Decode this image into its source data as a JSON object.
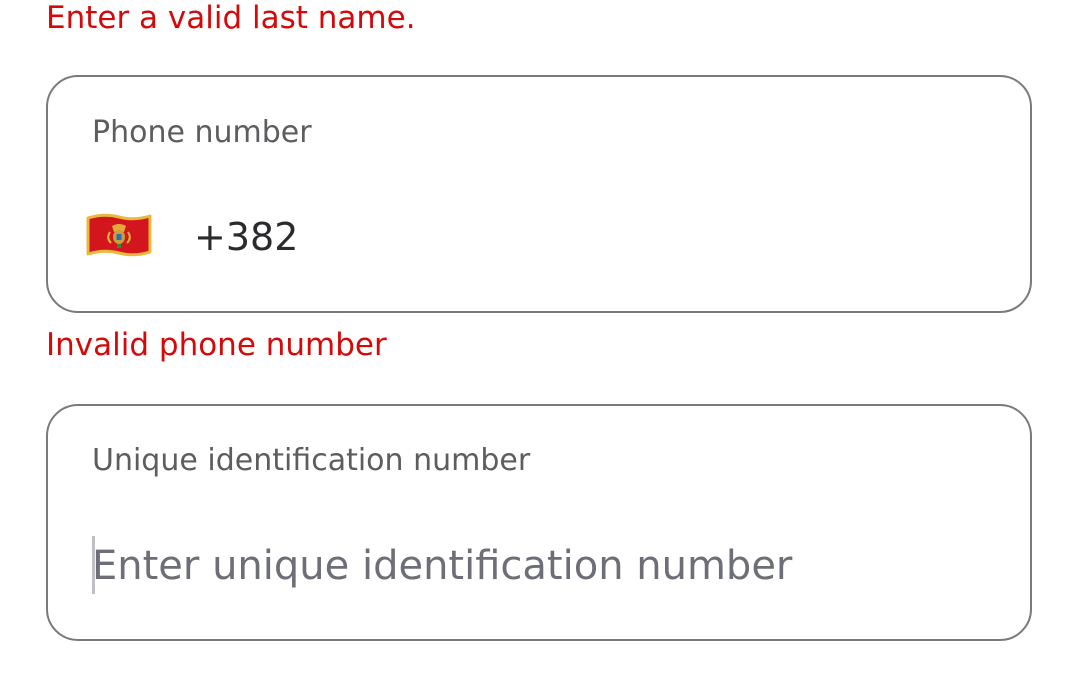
{
  "errors": {
    "last_name": "Enter a valid last name.",
    "phone": "Invalid phone number"
  },
  "phone_field": {
    "label": "Phone number",
    "country_flag_icon": "montenegro-flag-icon",
    "dial_code": "+382",
    "value": ""
  },
  "uid_field": {
    "label": "Unique identification number",
    "placeholder": "Enter unique identification number",
    "value": ""
  },
  "colors": {
    "error": "#d40a0a",
    "border": "#7a7a7c",
    "label": "#5d5d60",
    "placeholder": "#6d6e77",
    "flag_red": "#d3161d",
    "flag_gold": "#e8b93a"
  }
}
